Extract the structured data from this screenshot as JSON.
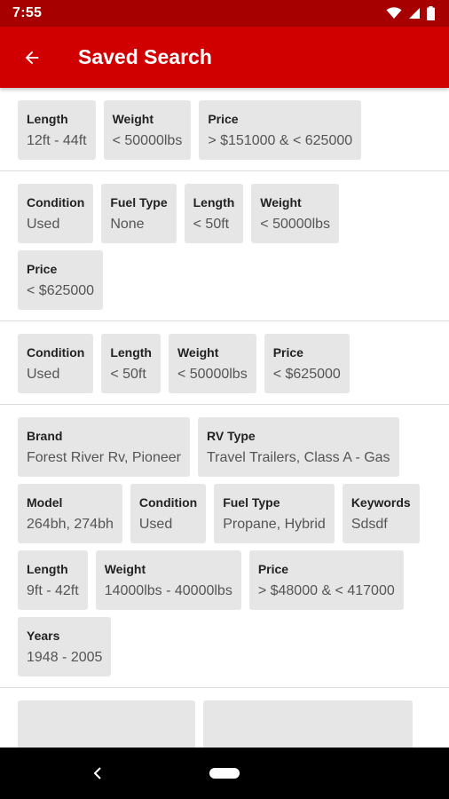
{
  "status_bar": {
    "time": "7:55"
  },
  "app_bar": {
    "title": "Saved Search"
  },
  "searches": [
    {
      "filters": [
        {
          "label": "Length",
          "value": "12ft - 44ft"
        },
        {
          "label": "Weight",
          "value": "< 50000lbs"
        },
        {
          "label": "Price",
          "value": "> $151000 & < 625000"
        }
      ]
    },
    {
      "filters": [
        {
          "label": "Condition",
          "value": "Used"
        },
        {
          "label": "Fuel Type",
          "value": "None"
        },
        {
          "label": "Length",
          "value": "< 50ft"
        },
        {
          "label": "Weight",
          "value": "< 50000lbs"
        },
        {
          "label": "Price",
          "value": "< $625000"
        }
      ]
    },
    {
      "filters": [
        {
          "label": "Condition",
          "value": "Used"
        },
        {
          "label": "Length",
          "value": "< 50ft"
        },
        {
          "label": "Weight",
          "value": "< 50000lbs"
        },
        {
          "label": "Price",
          "value": "< $625000"
        }
      ]
    },
    {
      "filters": [
        {
          "label": "Brand",
          "value": "Forest River Rv, Pioneer"
        },
        {
          "label": "RV Type",
          "value": "Travel Trailers, Class A - Gas"
        },
        {
          "label": "Model",
          "value": "264bh, 274bh"
        },
        {
          "label": "Condition",
          "value": "Used"
        },
        {
          "label": "Fuel Type",
          "value": "Propane, Hybrid"
        },
        {
          "label": "Keywords",
          "value": "Sdsdf"
        },
        {
          "label": "Length",
          "value": "9ft - 42ft"
        },
        {
          "label": "Weight",
          "value": "14000lbs - 40000lbs"
        },
        {
          "label": "Price",
          "value": "> $48000 & < 417000"
        },
        {
          "label": "Years",
          "value": "1948 - 2005"
        }
      ]
    }
  ],
  "colors": {
    "app_bar": "#d10000",
    "status_bar": "#a60000",
    "chip_bg": "#e6e6e6"
  },
  "icons": {
    "back": "arrow-left-icon",
    "wifi": "wifi-icon",
    "signal": "signal-icon",
    "battery": "battery-icon"
  }
}
